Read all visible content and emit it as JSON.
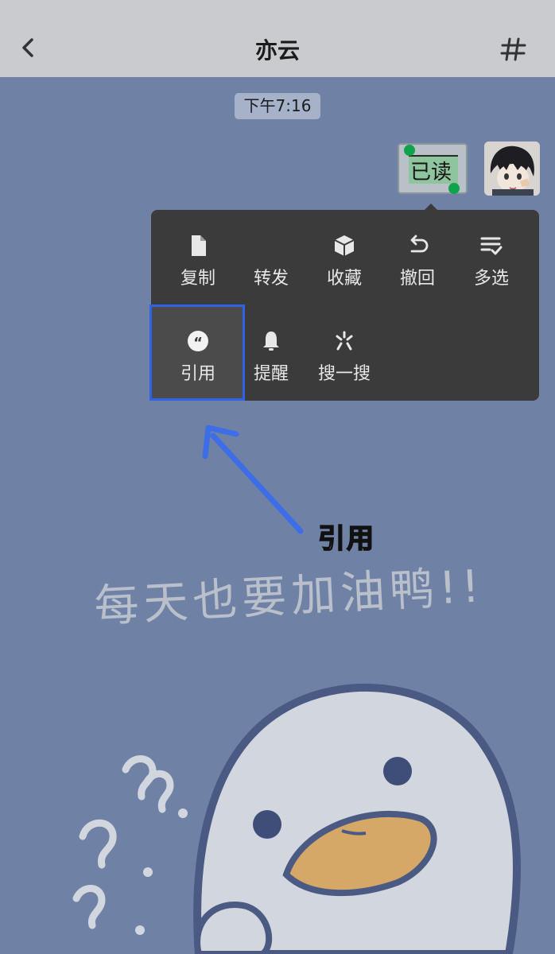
{
  "header": {
    "title": "亦云",
    "back_icon": "chevron-left-icon",
    "menu_icon": "hash-icon"
  },
  "chat": {
    "timestamp": "下午7:16",
    "message": {
      "text": "已读",
      "selection_color": "#8fc59e",
      "handle_color": "#10a34c"
    }
  },
  "context_menu": {
    "items": [
      {
        "label": "复制",
        "icon": "copy-file-icon"
      },
      {
        "label": "转发",
        "icon": "forward-icon"
      },
      {
        "label": "收藏",
        "icon": "favorite-box-icon"
      },
      {
        "label": "撤回",
        "icon": "undo-icon"
      },
      {
        "label": "多选",
        "icon": "multi-select-icon"
      },
      {
        "label": "引用",
        "icon": "quote-icon"
      },
      {
        "label": "提醒",
        "icon": "bell-icon"
      },
      {
        "label": "搜一搜",
        "icon": "search-spark-icon"
      }
    ],
    "highlight_color": "#2f63e6"
  },
  "annotation": {
    "label": "引用",
    "arrow_color": "#3d6ee8"
  },
  "wallpaper": {
    "text": "每天也要加油鸭!!",
    "background_color": "#6f82a5"
  }
}
